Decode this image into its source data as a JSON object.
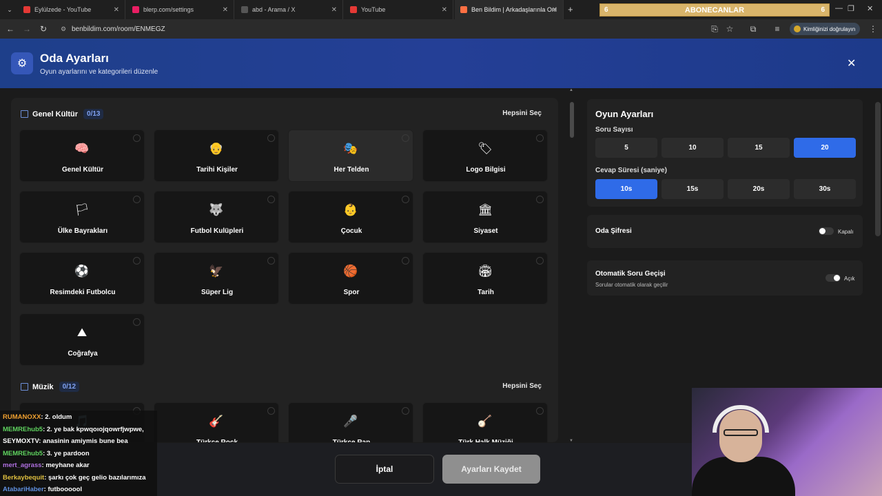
{
  "browser": {
    "tabs": [
      {
        "title": "Eylülzede - YouTube",
        "color": "#e53935"
      },
      {
        "title": "blerp.com/settings",
        "color": "#e91e63"
      },
      {
        "title": "abd - Arama / X",
        "color": "#555555"
      },
      {
        "title": "YouTube",
        "color": "#e53935"
      },
      {
        "title": "Ben Bildim | Arkadaşlarınla Onl...",
        "color": "#ff7043"
      }
    ],
    "new_tab_icon": "+",
    "url": "benbildim.com/room/ENMEGZ",
    "verify_label": "Kimliğinizi doğrulayın"
  },
  "overlay_banner": {
    "text": "ABONECANLAR",
    "left_num": "6",
    "right_num": "6"
  },
  "header": {
    "title": "Oda Ayarları",
    "subtitle": "Oyun ayarlarını ve kategorileri düzenle",
    "close_icon": "✕"
  },
  "sections": [
    {
      "title": "Genel Kültür",
      "count": "0/13",
      "select_all": "Hepsini Seç",
      "cards": [
        {
          "label": "Genel Kültür",
          "emoji": "🧠"
        },
        {
          "label": "Tarihi Kişiler",
          "emoji": "👴"
        },
        {
          "label": "Her Telden",
          "emoji": "🎭"
        },
        {
          "label": "Logo Bilgisi",
          "emoji": "🏷"
        },
        {
          "label": "Ülke Bayrakları",
          "emoji": "🏳"
        },
        {
          "label": "Futbol Kulüpleri",
          "emoji": "🐺"
        },
        {
          "label": "Çocuk",
          "emoji": "👶"
        },
        {
          "label": "Siyaset",
          "emoji": "🏛"
        },
        {
          "label": "Resimdeki Futbolcu",
          "emoji": "⚽"
        },
        {
          "label": "Süper Lig",
          "emoji": "🦅"
        },
        {
          "label": "Spor",
          "emoji": "🏀"
        },
        {
          "label": "Tarih",
          "emoji": "🏟"
        },
        {
          "label": "Coğrafya",
          "emoji": "⛰"
        }
      ]
    },
    {
      "title": "Müzik",
      "count": "0/12",
      "select_all": "Hepsini Seç",
      "cards": [
        {
          "label": "",
          "emoji": "🎵"
        },
        {
          "label": "Türkçe Rock",
          "emoji": "🎸"
        },
        {
          "label": "Türkçe Rap",
          "emoji": "🎤"
        },
        {
          "label": "Türk Halk Müziği",
          "emoji": "🪕"
        }
      ]
    }
  ],
  "game_settings": {
    "title": "Oyun Ayarları",
    "question_count_label": "Soru Sayısı",
    "question_counts": [
      "5",
      "10",
      "15",
      "20"
    ],
    "question_count_selected": "20",
    "answer_time_label": "Cevap Süresi (saniye)",
    "answer_times": [
      "10s",
      "15s",
      "20s",
      "30s"
    ],
    "answer_time_selected": "10s"
  },
  "room_password": {
    "label": "Oda Şifresi",
    "state": "Kapalı"
  },
  "auto_next": {
    "label": "Otomatik Soru Geçişi",
    "desc": "Sorular otomatik olarak geçilir",
    "state": "Açık"
  },
  "footer": {
    "cancel": "İptal",
    "save": "Ayarları Kaydet"
  },
  "chat": [
    {
      "user": "RUMANOXX",
      "text": ": 2. oldum",
      "color": "#f0a030"
    },
    {
      "user": "MEMREhub5",
      "text": ": 2. ye bak kpwqoıojqowrfjwpwe,",
      "color": "#5fd35f"
    },
    {
      "user": "SEYMOXTV",
      "text": ": anasinin amiymis bune bea",
      "color": "#ffffff"
    },
    {
      "user": "MEMREhub5",
      "text": ": 3. ye pardoon",
      "color": "#5fd35f"
    },
    {
      "user": "mert_agrass",
      "text": ": meyhane akar",
      "color": "#b070e0"
    },
    {
      "user": "Berkaybequit",
      "text": ": şarkı çok geç gelio bazılarımıza",
      "color": "#e0c040"
    },
    {
      "user": "AtabariHaber",
      "text": ": futboooool",
      "color": "#6090e0"
    }
  ]
}
